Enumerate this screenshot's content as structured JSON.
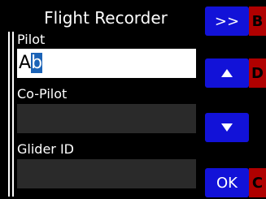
{
  "window": {
    "title": "Flight Recorder"
  },
  "fields": [
    {
      "label": "Pilot",
      "value_prefix": "A",
      "value_cursor": "b"
    },
    {
      "label": "Co-Pilot",
      "value": ""
    },
    {
      "label": "Glider ID",
      "value": ""
    }
  ],
  "buttons": {
    "next": {
      "label": ">>",
      "hotkey": "B"
    },
    "up": {
      "icon": "up-arrow-icon",
      "hotkey": "D"
    },
    "down": {
      "icon": "down-arrow-icon"
    },
    "ok": {
      "label": "OK",
      "hotkey": "C"
    }
  },
  "colors": {
    "button_blue": "#1212d8",
    "hotkey_red": "#b00000",
    "cursor_highlight": "#1b63b7"
  }
}
